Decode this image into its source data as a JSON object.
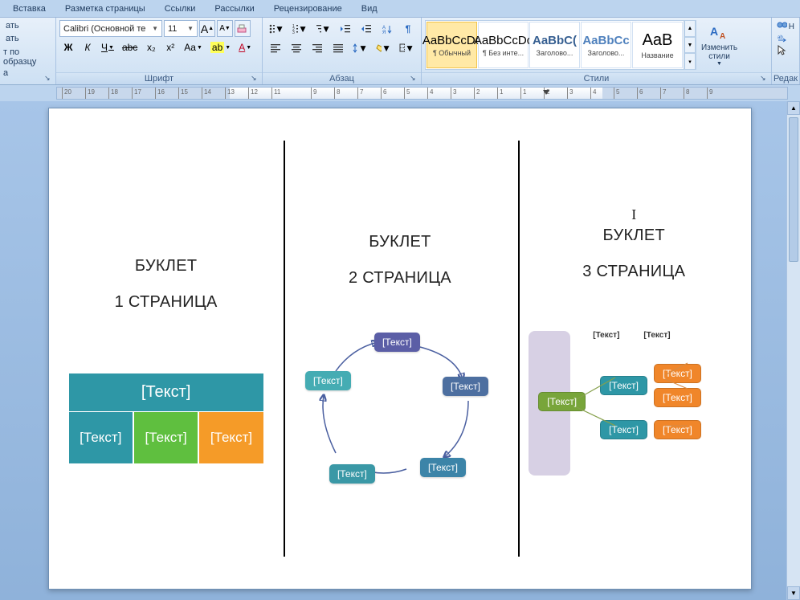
{
  "menu": {
    "items": [
      "Вставка",
      "Разметка страницы",
      "Ссылки",
      "Рассылки",
      "Рецензирование",
      "Вид"
    ]
  },
  "clipboard": {
    "cut": "ать",
    "copy": "ать",
    "brush": "т по образцу",
    "extra": "а"
  },
  "font_group": {
    "label": "Шрифт",
    "font_name": "Calibri (Основной те",
    "font_size": "11",
    "grow": "A",
    "shrink": "A",
    "clear": "Aa",
    "bold": "Ж",
    "italic": "К",
    "underline": "Ч",
    "strike": "abc",
    "sub": "x₂",
    "sup": "x²",
    "case": "Aa",
    "highlight": "ab",
    "fontcolor": "A"
  },
  "para_group": {
    "label": "Абзац"
  },
  "styles_group": {
    "label": "Стили",
    "tiles": [
      {
        "sample": "AaBbCcDc",
        "name": "¶ Обычный",
        "cls": "",
        "sel": true
      },
      {
        "sample": "AaBbCcDc",
        "name": "¶ Без инте...",
        "cls": "",
        "sel": false
      },
      {
        "sample": "AaBbC(",
        "name": "Заголово...",
        "cls": "blue",
        "sel": false
      },
      {
        "sample": "AaBbCc",
        "name": "Заголово...",
        "cls": "blue2",
        "sel": false
      },
      {
        "sample": "AaB",
        "name": "Название",
        "cls": "big",
        "sel": false
      }
    ],
    "change": "Изменить стили"
  },
  "edit_group": {
    "label": "Редак",
    "find": "Н",
    "replace": "А"
  },
  "ruler": {
    "labels_left": [
      "20",
      "19",
      "18",
      "17",
      "16",
      "15",
      "14",
      "13",
      "12",
      "11"
    ],
    "labels_right": [
      "9",
      "8",
      "7",
      "6",
      "5",
      "4",
      "3",
      "2",
      "1",
      "1",
      "2",
      "3",
      "4",
      "5",
      "6",
      "7",
      "8",
      "9"
    ]
  },
  "doc": {
    "col1": {
      "h1": "БУКЛЕТ",
      "h2": "1 СТРАНИЦА",
      "top": "[Текст]",
      "cells": [
        "[Текст]",
        "[Текст]",
        "[Текст]"
      ]
    },
    "col2": {
      "h1": "БУКЛЕТ",
      "h2": "2 СТРАНИЦА",
      "nodes": [
        "[Текст]",
        "[Текст]",
        "[Текст]",
        "[Текст]",
        "[Текст]"
      ]
    },
    "col3": {
      "pre": "I",
      "h1": "БУКЛЕТ",
      "h2": "3 СТРАНИЦА",
      "hdr": [
        "[Текст]",
        "[Текст]"
      ],
      "root": "[Текст]",
      "teal": [
        "[Текст]",
        "[Текст]"
      ],
      "orange": [
        "[Текст]",
        "[Текст]",
        "[Текст]"
      ]
    }
  }
}
